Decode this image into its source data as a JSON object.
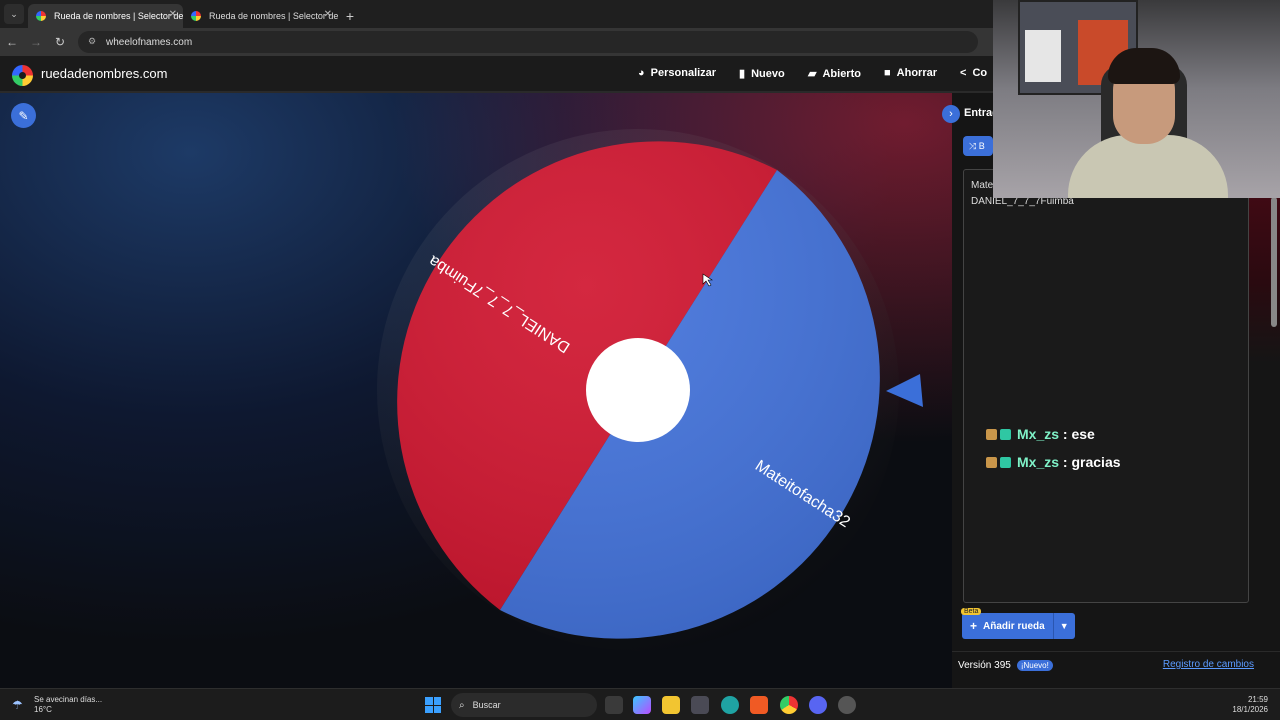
{
  "browser": {
    "tabs": [
      {
        "title": "Rueda de nombres | Selector de"
      },
      {
        "title": "Rueda de nombres | Selector de"
      }
    ],
    "url": "wheelofnames.com"
  },
  "header": {
    "brand": "ruedadenombres.com",
    "menu": {
      "customize": "Personalizar",
      "new": "Nuevo",
      "open": "Abierto",
      "save": "Ahorrar",
      "share": "Co"
    }
  },
  "wheel": {
    "colors": {
      "red": "#d0152f",
      "blue": "#4373dc",
      "center": "#ffffff"
    },
    "segments": [
      {
        "label": "DANIEL_7_7_7Fuimba"
      },
      {
        "label": "Mateitofacha32"
      }
    ]
  },
  "side": {
    "entries_tab": "Entrad",
    "shuffle_label": "B",
    "entries": [
      "Mate",
      "DANIEL_7_7_7Fuimba"
    ],
    "chat": [
      {
        "user": "Mx_zs",
        "sep": " : ",
        "message": "ese"
      },
      {
        "user": "Mx_zs",
        "sep": " : ",
        "message": "gracias"
      }
    ],
    "beta": "Beta",
    "add_wheel": "Añadir rueda",
    "version": "Versión 395",
    "new_badge": "¡Nuevo!",
    "changelog": "Registro de cambios"
  },
  "taskbar": {
    "weather_line1": "Se avecinan días...",
    "weather_line2": "16°C",
    "search": "Buscar",
    "time": "21:59",
    "date": "18/1/2026"
  },
  "icons": [
    "edit-icon",
    "shuffle-icon",
    "chevron-right-icon",
    "plus-icon",
    "caret-down-icon",
    "palette-icon",
    "file-icon",
    "folder-icon",
    "save-icon",
    "share-icon",
    "windows-start-icon",
    "search-icon",
    "weather-icon"
  ]
}
